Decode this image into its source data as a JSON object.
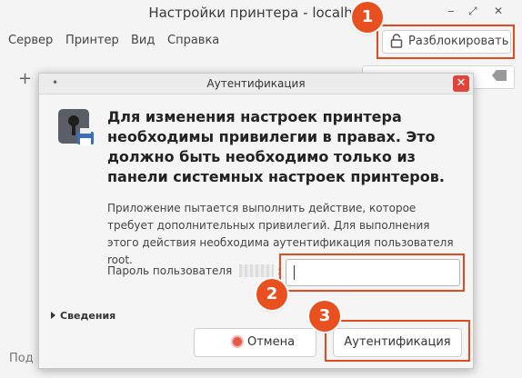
{
  "main_window": {
    "title": "Настройки принтера - localhost",
    "menu": [
      "Сервер",
      "Принтер",
      "Вид",
      "Справка"
    ],
    "unlock_label": "Разблокировать",
    "status_partial": "Под"
  },
  "dialog": {
    "title": "Аутентификация",
    "headline": "Для изменения настроек принтера необходимы привилегии в правах. Это должно быть необходимо только из панели системных настроек принтеров.",
    "description": "Приложение пытается выполнить действие, которое требует дополнительных привилегий. Для выполнения этого действия необходима аутентификация пользователя root.",
    "password_label": "Пароль пользователя",
    "password_colon": ":",
    "password_value": "",
    "details_label": "Сведения",
    "cancel_label": "Отмена",
    "auth_label": "Аутентификация"
  },
  "callouts": [
    "1",
    "2",
    "3"
  ],
  "colors": {
    "accent": "#e8501f",
    "close": "#e0453a"
  },
  "icons": [
    "lock-icon",
    "close-icon",
    "cancel-icon",
    "key-printer-icon",
    "add-icon",
    "clear-icon"
  ]
}
